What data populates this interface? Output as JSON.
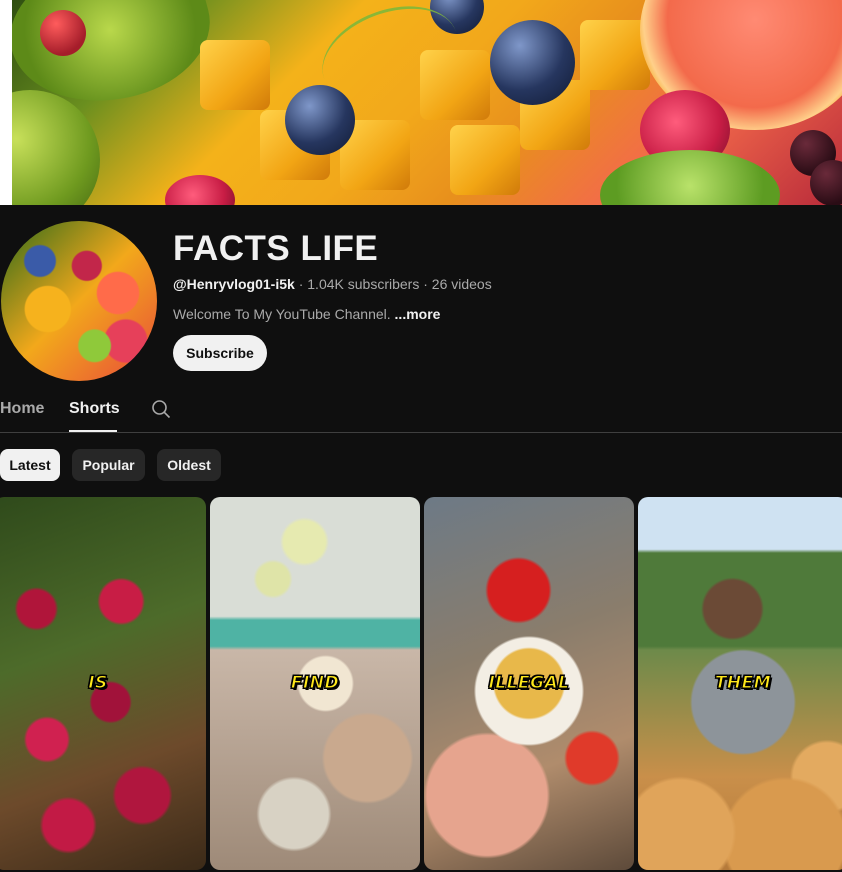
{
  "channel": {
    "title": "FACTS LIFE",
    "handle": "@Henryvlog01-i5k",
    "subscribers": "1.04K subscribers",
    "videos": "26 videos",
    "separator": " · ",
    "description": "Welcome To My YouTube Channel.",
    "more_label": "...more",
    "subscribe_label": "Subscribe"
  },
  "tabs": [
    {
      "label": "Home"
    },
    {
      "label": "Shorts"
    }
  ],
  "filters": [
    {
      "label": "Latest"
    },
    {
      "label": "Popular"
    },
    {
      "label": "Oldest"
    }
  ],
  "shorts": [
    {
      "caption": "IS"
    },
    {
      "caption": "FIND"
    },
    {
      "caption": "ILLEGAL"
    },
    {
      "caption": "THEM"
    }
  ],
  "icons": {
    "search_tab": "search-icon"
  },
  "colors": {
    "background": "#0f0f0f",
    "text_primary": "#f1f1f1",
    "text_secondary": "#aaaaaa",
    "chip_inactive": "#272727",
    "caption_yellow": "#ffe81a"
  }
}
